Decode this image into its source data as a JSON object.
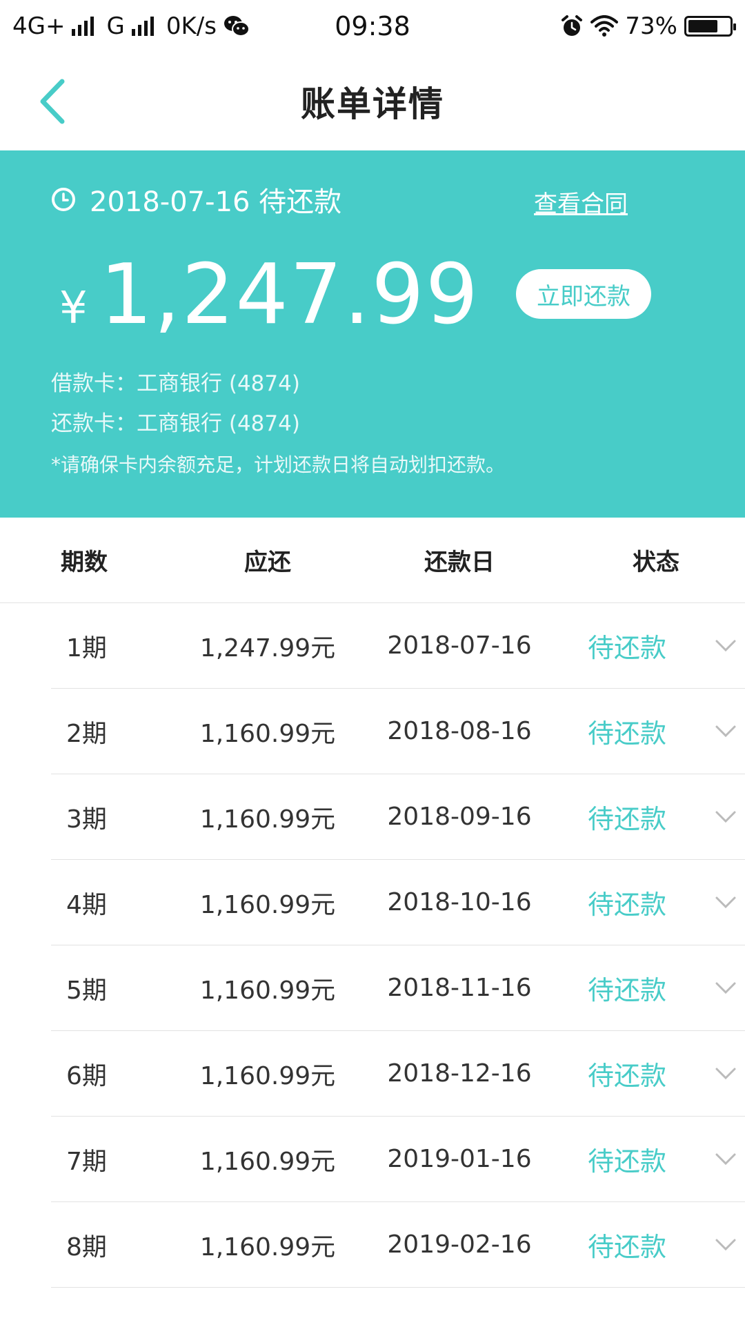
{
  "status_bar": {
    "network1": "4G+",
    "network2": "G",
    "speed": "0K/s",
    "time": "09:38",
    "battery": "73%",
    "battery_level": 0.73
  },
  "nav": {
    "title": "账单详情"
  },
  "summary": {
    "due_text": "2018-07-16 待还款",
    "contract_link": "查看合同",
    "currency": "¥",
    "amount": "1,247.99",
    "repay_button": "立即还款",
    "loan_card": "借款卡：工商银行 (4874)",
    "repay_card": "还款卡：工商银行 (4874)",
    "note": "*请确保卡内余额充足，计划还款日将自动划扣还款。"
  },
  "table": {
    "headers": {
      "period": "期数",
      "amount": "应还",
      "date": "还款日",
      "status": "状态"
    },
    "rows": [
      {
        "period": "1期",
        "amount": "1,247.99元",
        "date": "2018-07-16",
        "status": "待还款"
      },
      {
        "period": "2期",
        "amount": "1,160.99元",
        "date": "2018-08-16",
        "status": "待还款"
      },
      {
        "period": "3期",
        "amount": "1,160.99元",
        "date": "2018-09-16",
        "status": "待还款"
      },
      {
        "period": "4期",
        "amount": "1,160.99元",
        "date": "2018-10-16",
        "status": "待还款"
      },
      {
        "period": "5期",
        "amount": "1,160.99元",
        "date": "2018-11-16",
        "status": "待还款"
      },
      {
        "period": "6期",
        "amount": "1,160.99元",
        "date": "2018-12-16",
        "status": "待还款"
      },
      {
        "period": "7期",
        "amount": "1,160.99元",
        "date": "2019-01-16",
        "status": "待还款"
      },
      {
        "period": "8期",
        "amount": "1,160.99元",
        "date": "2019-02-16",
        "status": "待还款"
      }
    ]
  },
  "colors": {
    "accent": "#48ccc8",
    "text": "#222222",
    "divider": "#e2e2e2"
  },
  "icons": {
    "back": "back-arrow-icon",
    "clock": "clock-icon",
    "chevron": "chevron-down-icon",
    "wechat": "wechat-icon",
    "alarm": "alarm-icon",
    "wifi": "wifi-icon"
  }
}
